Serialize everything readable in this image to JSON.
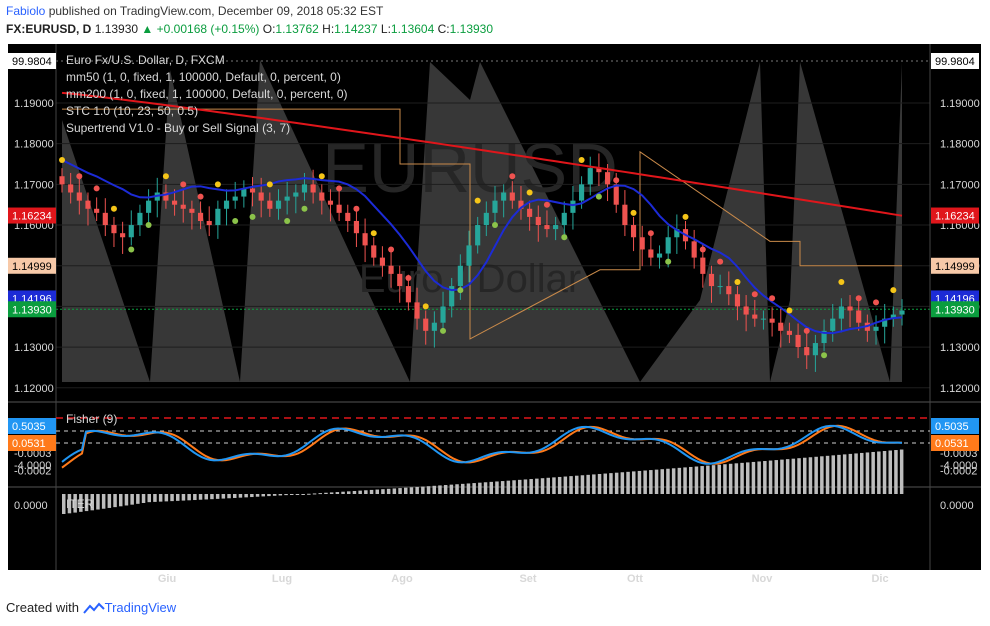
{
  "header": {
    "user": "Fabiolo",
    "published_text": "published on TradingView.com, December 09, 2018 05:32 EST",
    "symbol_line": "FX:EURUSD, D",
    "price": "1.13930",
    "change": "+0.00168 (+0.15%)",
    "o_label": "O:",
    "o_val": "1.13762",
    "h_label": "H:",
    "h_val": "1.14237",
    "l_label": "L:",
    "l_val": "1.13604",
    "c_label": "C:",
    "c_val": "1.13930"
  },
  "legend": {
    "title": "Euro Fx/U.S. Dollar, D, FXCM",
    "line1": "mm50 (1, 0, fixed, 1, 100000, Default, 0, percent, 0)",
    "line2": "mm200 (1, 0, fixed, 1, 100000, Default, 0, percent, 0)",
    "line3": "STC 1.0 (10, 23, 50, 0.5)",
    "line4": "Supertrend V1.0 - Buy or Sell Signal (3, 7)"
  },
  "watermark": {
    "top": "EURUSD",
    "bottom": "Euro / Dollar"
  },
  "footer": {
    "prefix": "Created with",
    "brand": "TradingView"
  },
  "colors": {
    "up": "#26a69a",
    "down": "#ef5350",
    "ma50": "#1c2bd6",
    "ma200": "#e0161b",
    "fisher_a": "#2196f3",
    "fisher_b": "#ff7a1a"
  },
  "chart_data": [
    {
      "type": "candlestick",
      "title": "Euro Fx/U.S. Dollar, D, FXCM",
      "x_ticks": [
        "Giu",
        "Lug",
        "Ago",
        "Set",
        "Ott",
        "Nov",
        "Dic"
      ],
      "y_ticks": [
        "1.19000",
        "1.18000",
        "1.17000",
        "1.16000",
        "1.15000",
        "1.14000",
        "1.13000",
        "1.12000"
      ],
      "ylim": [
        1.117,
        1.2045
      ],
      "price_labels": {
        "stc_top": "99.9804",
        "ma200": "1.16234",
        "supertrend": "1.14999",
        "ma50": "1.14196",
        "last": "1.13930"
      },
      "close_series": [
        1.17,
        1.168,
        1.166,
        1.164,
        1.163,
        1.16,
        1.158,
        1.157,
        1.16,
        1.163,
        1.166,
        1.168,
        1.166,
        1.165,
        1.164,
        1.163,
        1.161,
        1.16,
        1.164,
        1.166,
        1.167,
        1.169,
        1.168,
        1.166,
        1.164,
        1.166,
        1.167,
        1.168,
        1.17,
        1.168,
        1.166,
        1.165,
        1.163,
        1.161,
        1.158,
        1.155,
        1.152,
        1.15,
        1.148,
        1.145,
        1.141,
        1.137,
        1.134,
        1.136,
        1.14,
        1.145,
        1.15,
        1.155,
        1.16,
        1.163,
        1.166,
        1.168,
        1.166,
        1.164,
        1.162,
        1.16,
        1.159,
        1.16,
        1.163,
        1.166,
        1.17,
        1.174,
        1.173,
        1.17,
        1.165,
        1.16,
        1.157,
        1.154,
        1.152,
        1.153,
        1.157,
        1.159,
        1.156,
        1.152,
        1.148,
        1.145,
        1.145,
        1.143,
        1.14,
        1.138,
        1.137,
        1.137,
        1.136,
        1.134,
        1.133,
        1.13,
        1.128,
        1.131,
        1.134,
        1.137,
        1.14,
        1.139,
        1.136,
        1.134,
        1.135,
        1.137,
        1.138,
        1.139
      ]
    },
    {
      "type": "line",
      "title": "Fisher (9)",
      "y_ticks": [
        "-4.0000"
      ],
      "price_labels": {
        "fisher": "0.5035",
        "trigger": "0.0531"
      }
    },
    {
      "type": "bar",
      "title": "ITER",
      "y_ticks": [
        "0.0000",
        "-0.0002",
        "-0.0003"
      ],
      "ylim": [
        -0.00033,
        5e-05
      ]
    }
  ]
}
